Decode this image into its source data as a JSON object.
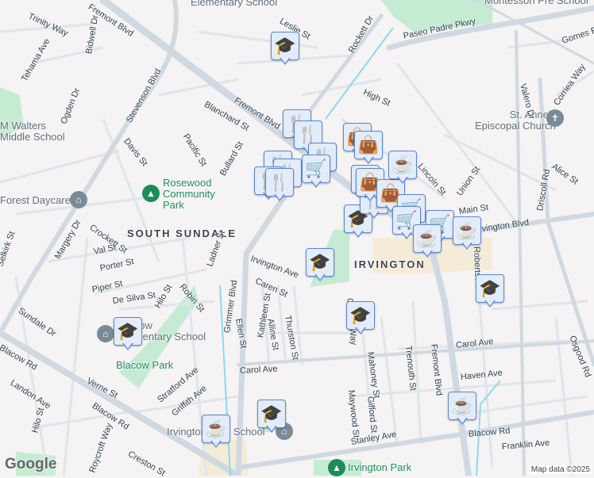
{
  "map": {
    "areas": [
      "SOUTH SUNDALE",
      "IRVINGTON"
    ],
    "pois": {
      "walters": "M Walters\nMiddle School",
      "daycare": "Forest Daycare",
      "elementary_top": "Elementary School",
      "montessori": "Montessori Pre School",
      "church": "St. Anne's\nEpiscopal Church",
      "blacow_school": "Blacow\nElementary School",
      "irvington_school": "Irvington High School"
    },
    "parks": {
      "rosewood": "Rosewood\nCommunity\nPark",
      "blacow": "Blacow Park",
      "irvington": "Irvington Park"
    },
    "streets": [
      "Fremont Blvd",
      "Trinity Way",
      "Tehama Ave",
      "Bidwell Dr",
      "Ogden Dr",
      "Stevenson Blvd",
      "Blanchard St",
      "Fremont Blvd",
      "Davis St",
      "Pacific St",
      "Bullard St",
      "Leslie St",
      "Rockett Dr",
      "Paseo Padre Pkwy",
      "High St",
      "Lincoln St",
      "Union St",
      "Main St",
      "Irvington Blvd",
      "Gomes Rd",
      "Valero Dr",
      "Corriea Way",
      "Driscoll Rd",
      "Alice St",
      "Crockett St",
      "Margery Dr",
      "Val St",
      "Porter St",
      "Piper St",
      "De Silva St",
      "Hilo St",
      "Robin St",
      "Ladner St",
      "Grimmer Blvd",
      "Irvington Ave",
      "Caren St",
      "Ellen St",
      "Kathleen St",
      "Alline St",
      "Thurston St",
      "Sundale Dr",
      "Blacow Rd",
      "Landon Ave",
      "Verne St",
      "Stratford Ave",
      "Griffith Ave",
      "Carol Ave",
      "Hilo St",
      "Roycroft Way",
      "Creston St",
      "Blacow Rd",
      "Chapel Way",
      "Mahoney St",
      "Trenouth St",
      "Fremont Blvd",
      "Carol Ave",
      "Haven Ave",
      "Maywood St",
      "Gifford St",
      "Stanley Ave",
      "Blacow Rd",
      "Franklin Ave",
      "Osgood Rd",
      "Roberts Ave",
      "Selkirk St"
    ],
    "markers": [
      "school",
      "school",
      "school",
      "school",
      "school",
      "school",
      "school",
      "restaurant",
      "restaurant",
      "restaurant",
      "restaurant",
      "restaurant",
      "restaurant",
      "restaurant",
      "restaurant",
      "shopping",
      "shopping",
      "shopping",
      "shopping",
      "shopping",
      "cafe",
      "cafe",
      "cafe",
      "cafe",
      "cafe",
      "grocery",
      "grocery",
      "grocery",
      "grocery"
    ],
    "attribution": "Map data ©2025",
    "logo": "Google"
  },
  "colors": {
    "road": "#d5dde5",
    "major": "#c9d3dd",
    "park": "#c5ecd3",
    "water": "#8ed8ea",
    "marker_bg": "#e3ecfb",
    "marker_border": "#5a86d6",
    "icon": "#0c3d66"
  }
}
